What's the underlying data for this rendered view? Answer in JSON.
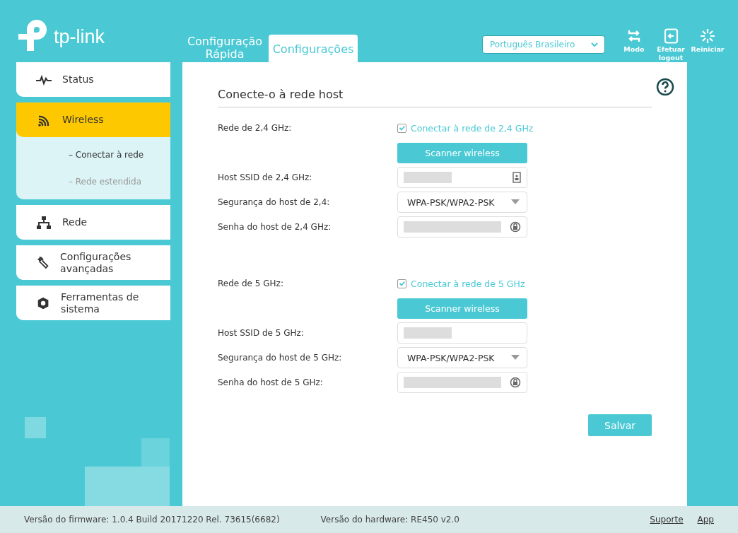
{
  "header": {
    "logo_text": "tp-link",
    "tabs": [
      {
        "label": "Configuração Rápida",
        "selected": false
      },
      {
        "label": "Configurações",
        "selected": true
      }
    ],
    "language": {
      "value": "Português Brasileiro"
    },
    "actions": [
      {
        "kind": "mode",
        "label": "Modo"
      },
      {
        "kind": "logout",
        "label": "Efetuar logout"
      },
      {
        "kind": "reboot",
        "label": "Reiniciar"
      }
    ]
  },
  "sidebar": {
    "items": [
      {
        "label": "Status",
        "selected": false
      },
      {
        "label": "Wireless",
        "selected": true,
        "children": [
          {
            "label": "– Conectar à rede",
            "selected": true
          },
          {
            "label": "– Rede estendida",
            "selected": false
          }
        ]
      },
      {
        "label": "Rede",
        "selected": false
      },
      {
        "label": "Configurações avançadas",
        "selected": false
      },
      {
        "label": "Ferramentas de sistema",
        "selected": false
      }
    ]
  },
  "main": {
    "title": "Conecte-o à rede host",
    "sections": [
      {
        "label": "Rede de 2,4 GHz:",
        "checkbox": {
          "label": "Conectar à rede de 2,4 GHz",
          "checked": true
        },
        "scan_button": "Scanner wireless",
        "ssid_label": "Host SSID de 2,4 GHz:",
        "security_label": "Segurança do host de 2,4:",
        "security_value": "WPA-PSK/WPA2-PSK",
        "password_label": "Senha do host de 2,4 GHz:"
      },
      {
        "label": "Rede de 5 GHz:",
        "checkbox": {
          "label": "Conectar à rede de 5 GHz",
          "checked": true
        },
        "scan_button": "Scanner wireless",
        "ssid_label": "Host SSID de 5 GHz:",
        "security_label": "Segurança do host de 5 GHz:",
        "security_value": "WPA-PSK/WPA2-PSK",
        "password_label": "Senha do host de 5 GHz:"
      }
    ],
    "save_button": "Salvar"
  },
  "status_bar": {
    "firmware": "Versão do firmware: 1.0.4 Build 20171220 Rel. 73615(6682)",
    "hardware": "Versão do hardware: RE450 v2.0",
    "links": [
      "Suporte",
      "App"
    ]
  }
}
